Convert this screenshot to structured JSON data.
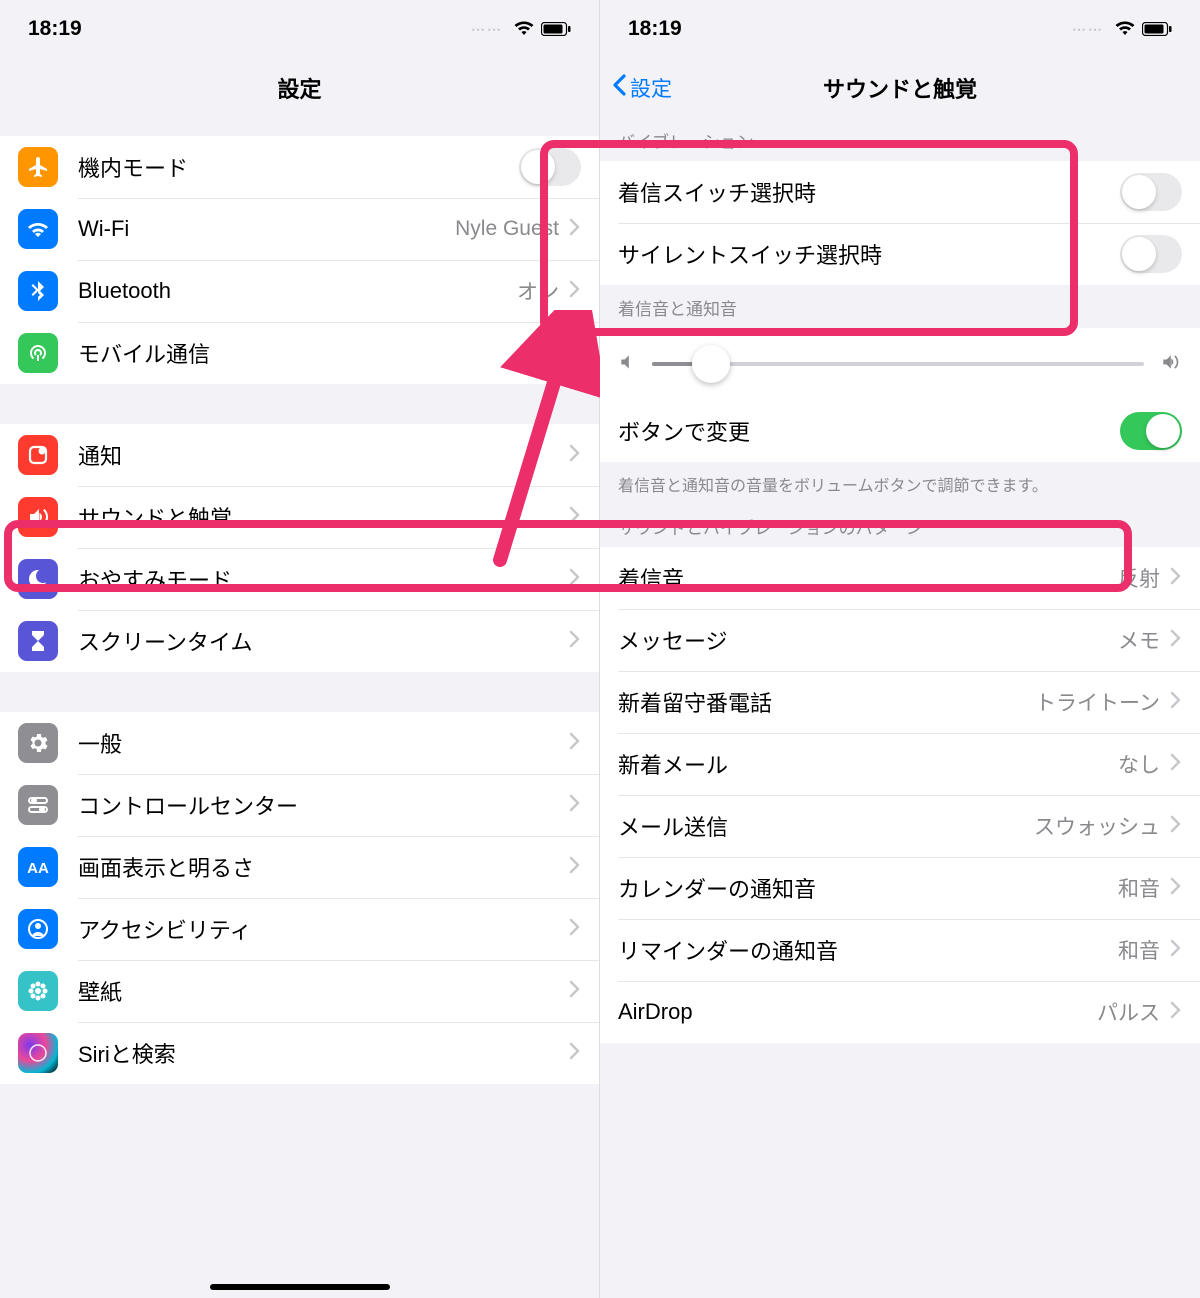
{
  "status": {
    "time": "18:19"
  },
  "left": {
    "title": "設定",
    "groups": [
      [
        {
          "id": "airplane",
          "label": "機内モード",
          "type": "toggle",
          "on": false,
          "icon": "airplane",
          "color": "ic-orange"
        },
        {
          "id": "wifi",
          "label": "Wi-Fi",
          "type": "link",
          "value": "Nyle Guest",
          "icon": "wifi",
          "color": "ic-blue"
        },
        {
          "id": "bluetooth",
          "label": "Bluetooth",
          "type": "link",
          "value": "オン",
          "icon": "bluetooth",
          "color": "ic-blue2"
        },
        {
          "id": "cellular",
          "label": "モバイル通信",
          "type": "link",
          "value": "",
          "icon": "antenna",
          "color": "ic-green"
        }
      ],
      [
        {
          "id": "notifications",
          "label": "通知",
          "type": "link",
          "value": "",
          "icon": "notif",
          "color": "ic-red"
        },
        {
          "id": "sounds",
          "label": "サウンドと触覚",
          "type": "link",
          "value": "",
          "icon": "speaker",
          "color": "ic-red2"
        },
        {
          "id": "dnd",
          "label": "おやすみモード",
          "type": "link",
          "value": "",
          "icon": "moon",
          "color": "ic-purple"
        },
        {
          "id": "screentime",
          "label": "スクリーンタイム",
          "type": "link",
          "value": "",
          "icon": "hourglass",
          "color": "ic-indigo"
        }
      ],
      [
        {
          "id": "general",
          "label": "一般",
          "type": "link",
          "value": "",
          "icon": "gear",
          "color": "ic-gray"
        },
        {
          "id": "control",
          "label": "コントロールセンター",
          "type": "link",
          "value": "",
          "icon": "switches",
          "color": "ic-gray2"
        },
        {
          "id": "display",
          "label": "画面表示と明るさ",
          "type": "link",
          "value": "",
          "icon": "aa",
          "color": "ic-blue3"
        },
        {
          "id": "accessibility",
          "label": "アクセシビリティ",
          "type": "link",
          "value": "",
          "icon": "person",
          "color": "ic-blue4"
        },
        {
          "id": "wallpaper",
          "label": "壁紙",
          "type": "link",
          "value": "",
          "icon": "flower",
          "color": "ic-teal"
        },
        {
          "id": "siri",
          "label": "Siriと検索",
          "type": "link",
          "value": "",
          "icon": "siri",
          "color": "siri-grad"
        }
      ]
    ]
  },
  "right": {
    "back": "設定",
    "title": "サウンドと触覚",
    "vibration_header": "バイブレーション",
    "vibration": [
      {
        "id": "ring-switch",
        "label": "着信スイッチ選択時",
        "on": false
      },
      {
        "id": "silent-switch",
        "label": "サイレントスイッチ選択時",
        "on": false
      }
    ],
    "ringer_header": "着信音と通知音",
    "button_change": {
      "label": "ボタンで変更",
      "on": true
    },
    "ringer_footer": "着信音と通知音の音量をボリュームボタンで調節できます。",
    "patterns_header": "サウンドとバイブレーションのパターン",
    "patterns": [
      {
        "id": "ringtone",
        "label": "着信音",
        "value": "反射"
      },
      {
        "id": "text",
        "label": "メッセージ",
        "value": "メモ"
      },
      {
        "id": "voicemail",
        "label": "新着留守番電話",
        "value": "トライトーン"
      },
      {
        "id": "newmail",
        "label": "新着メール",
        "value": "なし"
      },
      {
        "id": "sentmail",
        "label": "メール送信",
        "value": "スウォッシュ"
      },
      {
        "id": "calendar",
        "label": "カレンダーの通知音",
        "value": "和音"
      },
      {
        "id": "reminder",
        "label": "リマインダーの通知音",
        "value": "和音"
      },
      {
        "id": "airdrop",
        "label": "AirDrop",
        "value": "パルス"
      }
    ]
  }
}
